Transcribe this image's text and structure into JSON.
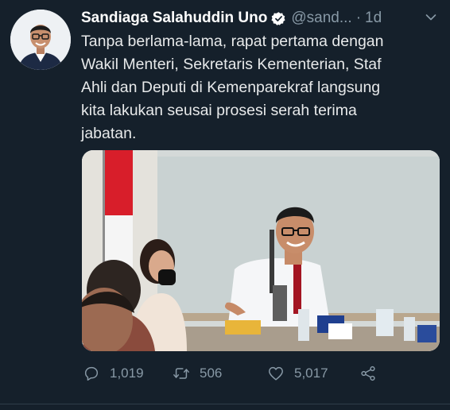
{
  "author": {
    "display_name": "Sandiaga Salahuddin Uno",
    "handle": "@sand...",
    "separator": "·",
    "time": "1d",
    "verified": true
  },
  "tweet": {
    "text_lines": [
      "Tanpa berlama-lama, rapat pertama dengan",
      "Wakil Menteri, Sekretaris Kementerian, Staf",
      "Ahli dan Deputi di Kemenparekraf langsung",
      "kita lakukan seusai prosesi serah terima",
      "jabatan."
    ]
  },
  "stats": {
    "replies": "1,019",
    "retweets": "506",
    "likes": "5,017"
  },
  "icons": {
    "verified": "verified-badge-icon",
    "more": "chevron-down-icon",
    "reply": "reply-icon",
    "retweet": "retweet-icon",
    "like": "heart-icon",
    "share": "share-icon"
  },
  "colors": {
    "background": "#15202b",
    "text": "#e7e9ea",
    "secondary": "#8899a6"
  }
}
